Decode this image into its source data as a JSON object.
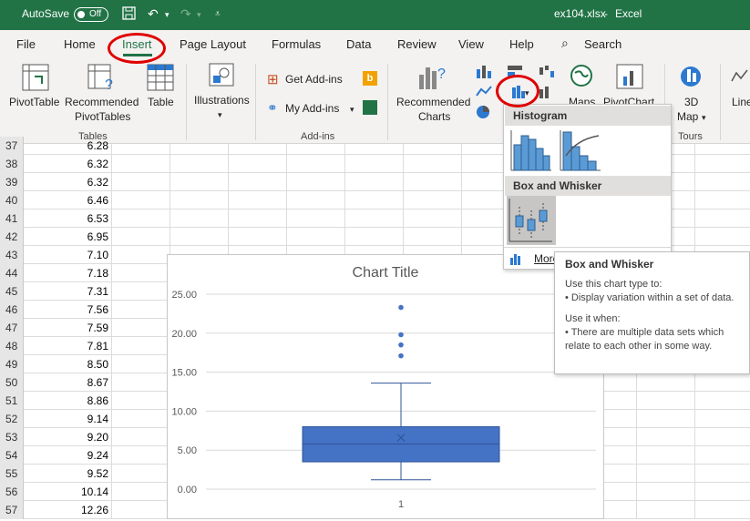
{
  "titlebar": {
    "autosave_label": "AutoSave",
    "autosave_state": "Off",
    "filename": "ex104.xlsx",
    "separator": "-",
    "app_name": "Excel",
    "color": "#217346"
  },
  "tabs": [
    {
      "label": "File"
    },
    {
      "label": "Home"
    },
    {
      "label": "Insert"
    },
    {
      "label": "Page Layout"
    },
    {
      "label": "Formulas"
    },
    {
      "label": "Data"
    },
    {
      "label": "Review"
    },
    {
      "label": "View"
    },
    {
      "label": "Help"
    }
  ],
  "search": {
    "label": "Search",
    "icon": "magnifier-icon"
  },
  "ribbon": {
    "pivottable": "PivotTable",
    "recommended_pivottables_1": "Recommended",
    "recommended_pivottables_2": "PivotTables",
    "table": "Table",
    "group_tables": "Tables",
    "illustrations": "Illustrations",
    "get_addins": "Get Add-ins",
    "my_addins": "My Add-ins",
    "group_addins": "Add-ins",
    "recommended_charts_1": "Recommended",
    "recommended_charts_2": "Charts",
    "maps": "Maps",
    "pivotchart": "PivotChart",
    "map3d_1": "3D",
    "map3d_2": "Map",
    "group_tours": "Tours",
    "line": "Line"
  },
  "dropdown": {
    "histogram_header": "Histogram",
    "boxwhisker_header": "Box and Whisker",
    "more_label": "More"
  },
  "tooltip": {
    "title": "Box and Whisker",
    "line1": "Use this chart type to:",
    "line2": "• Display variation within a set of data.",
    "line3": "Use it when:",
    "line4": "• There are multiple data sets which relate to each other in some way."
  },
  "rows": [
    {
      "num": "37",
      "val": "6.28"
    },
    {
      "num": "38",
      "val": "6.32"
    },
    {
      "num": "39",
      "val": "6.32"
    },
    {
      "num": "40",
      "val": "6.46"
    },
    {
      "num": "41",
      "val": "6.53"
    },
    {
      "num": "42",
      "val": "6.95"
    },
    {
      "num": "43",
      "val": "7.10"
    },
    {
      "num": "44",
      "val": "7.18"
    },
    {
      "num": "45",
      "val": "7.31"
    },
    {
      "num": "46",
      "val": "7.56"
    },
    {
      "num": "47",
      "val": "7.59"
    },
    {
      "num": "48",
      "val": "7.81"
    },
    {
      "num": "49",
      "val": "8.50"
    },
    {
      "num": "50",
      "val": "8.67"
    },
    {
      "num": "51",
      "val": "8.86"
    },
    {
      "num": "52",
      "val": "9.14"
    },
    {
      "num": "53",
      "val": "9.20"
    },
    {
      "num": "54",
      "val": "9.24"
    },
    {
      "num": "55",
      "val": "9.52"
    },
    {
      "num": "56",
      "val": "10.14"
    },
    {
      "num": "57",
      "val": "12.26"
    }
  ],
  "chart_data": {
    "type": "box",
    "title": "Chart Title",
    "categories": [
      "1"
    ],
    "yticks": [
      "25.00",
      "20.00",
      "15.00",
      "10.00",
      "5.00",
      "0.00"
    ],
    "ylim": [
      0,
      25
    ],
    "box": {
      "min": 1.2,
      "q1": 3.5,
      "median": 5.8,
      "q3": 8.0,
      "max": 13.6,
      "mean": 6.6
    },
    "outliers": [
      17.1,
      18.5,
      19.8,
      23.3
    ],
    "color": "#4472c4",
    "grid": true
  }
}
